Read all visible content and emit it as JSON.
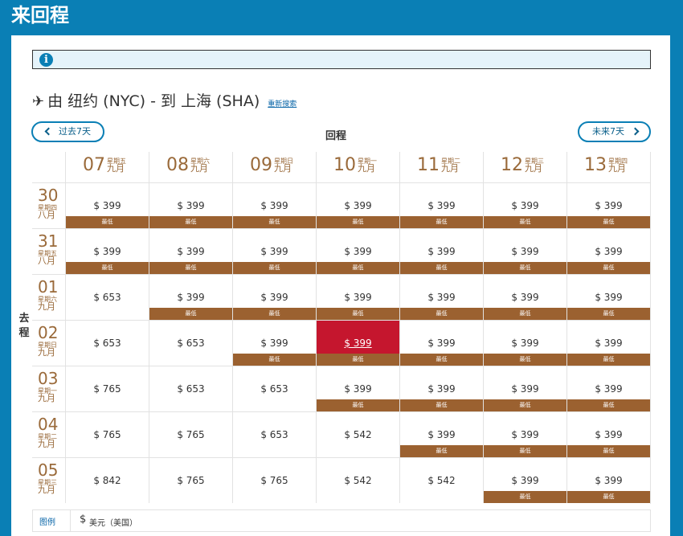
{
  "header": {
    "title": "来回程"
  },
  "info_icon": "info-icon",
  "route": {
    "text": "由 纽约 (NYC) - 到 上海 (SHA)",
    "new_search": "重新搜索"
  },
  "nav": {
    "prev_label": "过去7天",
    "next_label": "未来7天"
  },
  "return_label": "回程",
  "depart_label": "去程",
  "low_label": "最低",
  "return_dates": [
    {
      "day": "07",
      "weekday": "星期五",
      "month": "九月"
    },
    {
      "day": "08",
      "weekday": "星期六",
      "month": "九月"
    },
    {
      "day": "09",
      "weekday": "星期日",
      "month": "九月"
    },
    {
      "day": "10",
      "weekday": "星期一",
      "month": "九月"
    },
    {
      "day": "11",
      "weekday": "星期二",
      "month": "九月"
    },
    {
      "day": "12",
      "weekday": "星期三",
      "month": "九月"
    },
    {
      "day": "13",
      "weekday": "星期四",
      "month": "九月"
    }
  ],
  "depart_dates": [
    {
      "day": "30",
      "weekday": "星期四",
      "month": "八月"
    },
    {
      "day": "31",
      "weekday": "星期五",
      "month": "八月"
    },
    {
      "day": "01",
      "weekday": "星期六",
      "month": "九月"
    },
    {
      "day": "02",
      "weekday": "星期日",
      "month": "九月"
    },
    {
      "day": "03",
      "weekday": "星期一",
      "month": "九月"
    },
    {
      "day": "04",
      "weekday": "星期二",
      "month": "九月"
    },
    {
      "day": "05",
      "weekday": "星期三",
      "month": "九月"
    }
  ],
  "fares": [
    [
      {
        "price": "$ 399",
        "low": true
      },
      {
        "price": "$ 399",
        "low": true
      },
      {
        "price": "$ 399",
        "low": true
      },
      {
        "price": "$ 399",
        "low": true
      },
      {
        "price": "$ 399",
        "low": true
      },
      {
        "price": "$ 399",
        "low": true
      },
      {
        "price": "$ 399",
        "low": true
      }
    ],
    [
      {
        "price": "$ 399",
        "low": true
      },
      {
        "price": "$ 399",
        "low": true
      },
      {
        "price": "$ 399",
        "low": true
      },
      {
        "price": "$ 399",
        "low": true
      },
      {
        "price": "$ 399",
        "low": true
      },
      {
        "price": "$ 399",
        "low": true
      },
      {
        "price": "$ 399",
        "low": true
      }
    ],
    [
      {
        "price": "$ 653",
        "low": false
      },
      {
        "price": "$ 399",
        "low": true
      },
      {
        "price": "$ 399",
        "low": true
      },
      {
        "price": "$ 399",
        "low": true
      },
      {
        "price": "$ 399",
        "low": true
      },
      {
        "price": "$ 399",
        "low": true
      },
      {
        "price": "$ 399",
        "low": true
      }
    ],
    [
      {
        "price": "$ 653",
        "low": false
      },
      {
        "price": "$ 653",
        "low": false
      },
      {
        "price": "$ 399",
        "low": true
      },
      {
        "price": "$ 399",
        "low": true,
        "selected": true
      },
      {
        "price": "$ 399",
        "low": true
      },
      {
        "price": "$ 399",
        "low": true
      },
      {
        "price": "$ 399",
        "low": true
      }
    ],
    [
      {
        "price": "$ 765",
        "low": false
      },
      {
        "price": "$ 653",
        "low": false
      },
      {
        "price": "$ 653",
        "low": false
      },
      {
        "price": "$ 399",
        "low": true
      },
      {
        "price": "$ 399",
        "low": true
      },
      {
        "price": "$ 399",
        "low": true
      },
      {
        "price": "$ 399",
        "low": true
      }
    ],
    [
      {
        "price": "$ 765",
        "low": false
      },
      {
        "price": "$ 765",
        "low": false
      },
      {
        "price": "$ 653",
        "low": false
      },
      {
        "price": "$ 542",
        "low": false
      },
      {
        "price": "$ 399",
        "low": true
      },
      {
        "price": "$ 399",
        "low": true
      },
      {
        "price": "$ 399",
        "low": true
      }
    ],
    [
      {
        "price": "$ 842",
        "low": false
      },
      {
        "price": "$ 765",
        "low": false
      },
      {
        "price": "$ 765",
        "low": false
      },
      {
        "price": "$ 542",
        "low": false
      },
      {
        "price": "$ 542",
        "low": false
      },
      {
        "price": "$ 399",
        "low": true
      },
      {
        "price": "$ 399",
        "low": true
      }
    ]
  ],
  "legend": {
    "label": "图例",
    "currency_symbol": "$",
    "currency_text": "美元（美国）"
  },
  "colors": {
    "brand_blue": "#0a7fb5",
    "date_brown": "#9a6a3a",
    "low_tag": "#9b6130",
    "selected_red": "#c5162e"
  }
}
